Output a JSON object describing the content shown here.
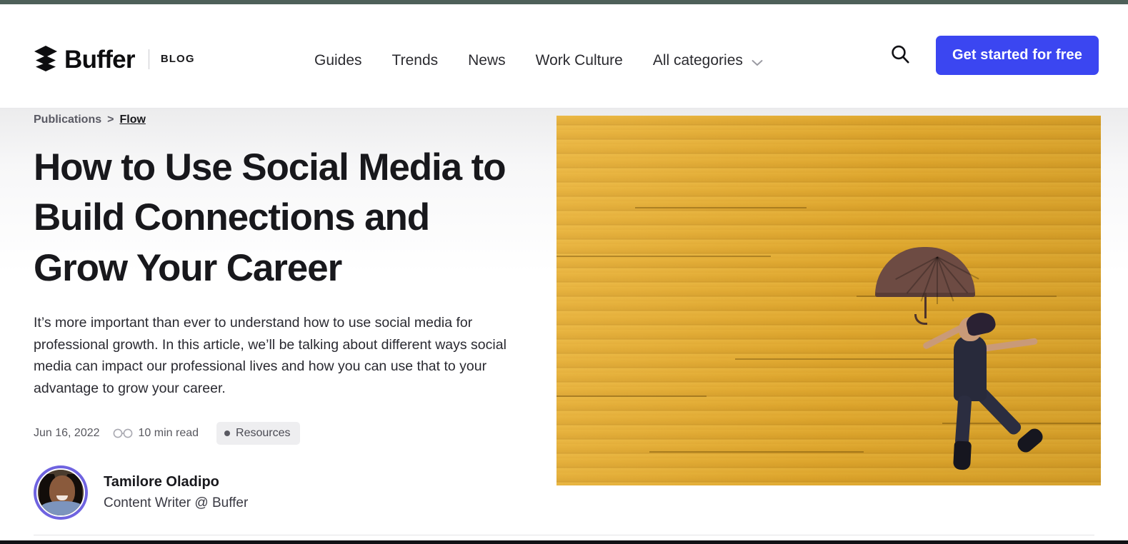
{
  "header": {
    "brand_name": "Buffer",
    "brand_sub": "BLOG",
    "logo_icon": "buffer-stacked-layers-icon",
    "nav_items": [
      {
        "label": "Guides"
      },
      {
        "label": "Trends"
      },
      {
        "label": "News"
      },
      {
        "label": "Work Culture"
      }
    ],
    "dropdown": {
      "label": "All categories",
      "icon": "chevron-down-icon"
    },
    "search": {
      "icon": "search-icon",
      "label": "Search"
    },
    "cta": {
      "label": "Get started for free",
      "color": "#3b46f1",
      "text_color": "#ffffff"
    },
    "top_strip_color": "#4e6059"
  },
  "hero": {
    "breadcrumb": {
      "parent": "Publications",
      "separator": ">",
      "current": "Flow"
    },
    "title": "How to Use Social Media to Build Connections and Grow Your Career",
    "description": "It’s more important than ever to understand how to use social media for professional growth. In this article, we’ll be talking about different ways social media can impact our professional lives and how you can use that to your advantage to grow your career.",
    "meta": {
      "date": "Jun 16, 2022",
      "read_time": "10 min read",
      "read_time_icon": "glasses-icon",
      "tag": "Resources",
      "tag_dot_color": "#5a5a62",
      "tag_bg_color": "#eeeef0"
    },
    "author": {
      "avatar_icon": "author-avatar",
      "avatar_ring_color": "#6f63e0",
      "name": "Tamilore Oladipo",
      "role": "Content Writer @ Buffer"
    },
    "image": {
      "alt": "Woman jumping while holding a brown umbrella in front of a yellow wooden plank wall",
      "wall_color": "#e2a930",
      "umbrella_color": "#6d4b43"
    },
    "accent_color": "#2c2ce0"
  }
}
